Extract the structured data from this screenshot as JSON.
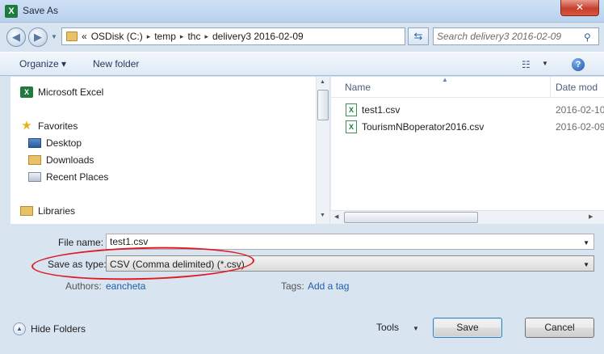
{
  "window": {
    "title": "Save As",
    "close_symbol": "✕"
  },
  "address": {
    "crumbs": [
      "«",
      "OSDisk (C:)",
      "temp",
      "thc",
      "delivery3 2016-02-09"
    ],
    "separator": "▸",
    "search_placeholder": "Search delivery3 2016-02-09"
  },
  "toolbar": {
    "organize": "Organize ▾",
    "new_folder": "New folder",
    "help": "?"
  },
  "nav": {
    "items": [
      {
        "label": "Microsoft Excel",
        "icon": "excel-icon"
      },
      {
        "label": "Favorites",
        "icon": "star-icon"
      },
      {
        "label": "Desktop",
        "icon": "desktop-icon"
      },
      {
        "label": "Downloads",
        "icon": "downloads-folder-icon"
      },
      {
        "label": "Recent Places",
        "icon": "recent-places-icon"
      },
      {
        "label": "Libraries",
        "icon": "libraries-icon"
      }
    ]
  },
  "files": {
    "columns": {
      "name": "Name",
      "date": "Date mod"
    },
    "rows": [
      {
        "name": "test1.csv",
        "date": "2016-02-10"
      },
      {
        "name": "TourismNBoperator2016.csv",
        "date": "2016-02-09"
      }
    ]
  },
  "form": {
    "file_name_label": "File name:",
    "file_name_value": "test1.csv",
    "save_type_label": "Save as type:",
    "save_type_value": "CSV (Comma delimited) (*.csv)",
    "authors_label": "Authors:",
    "authors_value": "eancheta",
    "tags_label": "Tags:",
    "tags_value": "Add a tag"
  },
  "footer": {
    "hide_folders": "Hide Folders",
    "tools": "Tools",
    "save": "Save",
    "cancel": "Cancel"
  },
  "colors": {
    "annotation": "#e01b24",
    "excel_green": "#1f7a3d",
    "link": "#1f5fa9"
  }
}
